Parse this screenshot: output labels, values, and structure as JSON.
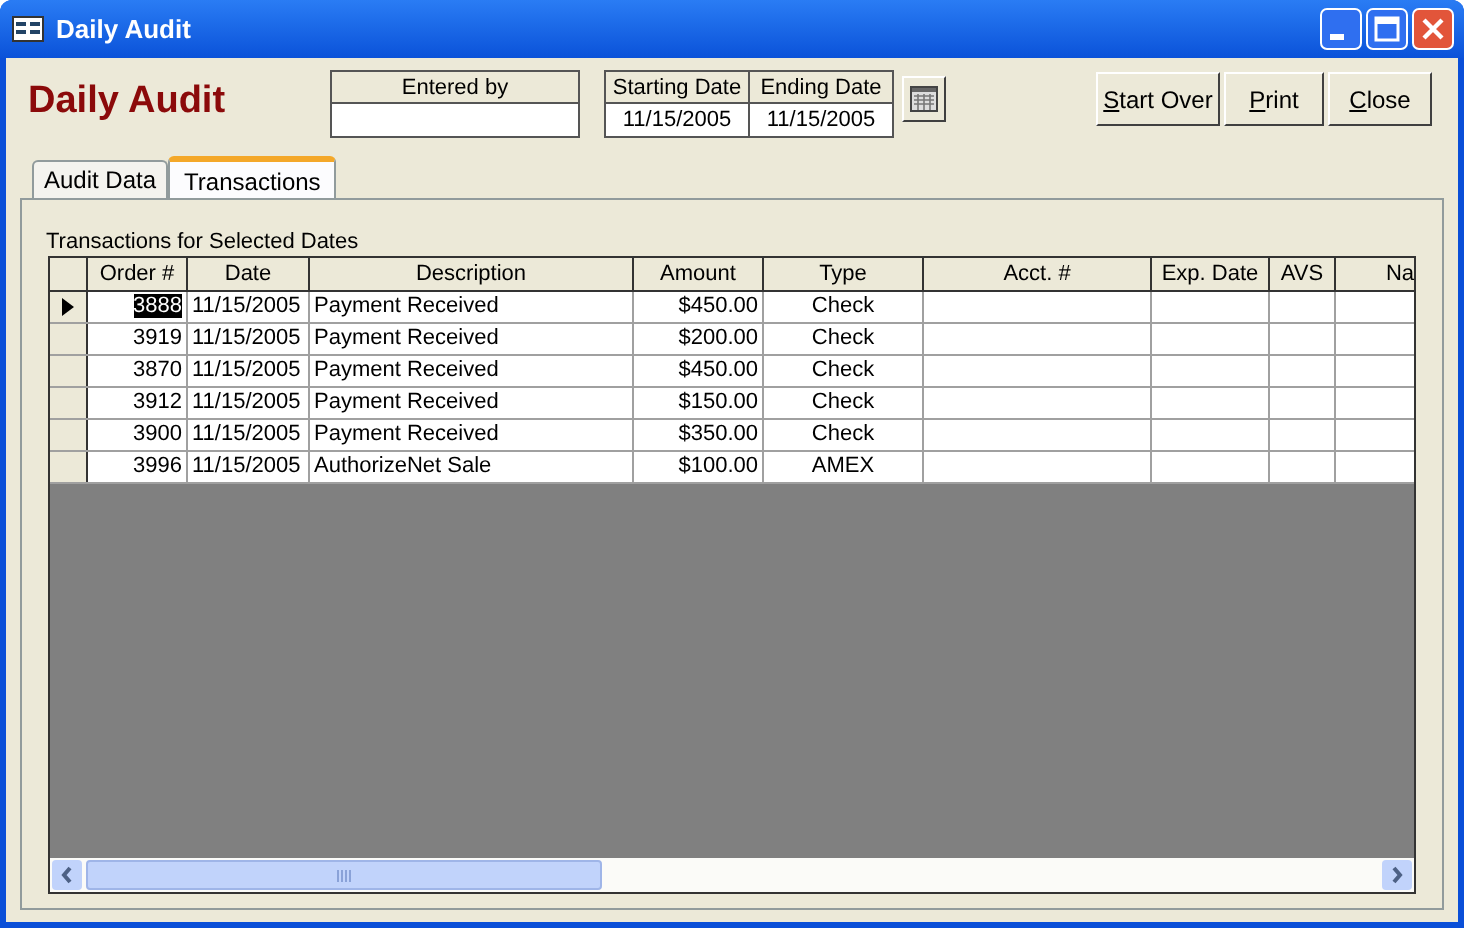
{
  "window": {
    "title": "Daily Audit"
  },
  "header": {
    "title": "Daily Audit",
    "entered_by": {
      "label": "Entered by"
    },
    "starting_date": {
      "label": "Starting Date",
      "value": "11/15/2005"
    },
    "ending_date": {
      "label": "Ending Date",
      "value": "11/15/2005"
    }
  },
  "buttons": [
    {
      "label": "Start Over",
      "underline_first": true
    },
    {
      "label": "Print",
      "underline_first": true
    },
    {
      "label": "Close",
      "underline_first": true
    }
  ],
  "tabs": [
    {
      "label": "Audit Data",
      "selected": false
    },
    {
      "label": "Transactions",
      "selected": true
    }
  ],
  "grid": {
    "caption": "Transactions for Selected Dates",
    "columns": [
      "Order #",
      "Date",
      "Description",
      "Amount",
      "Type",
      "Acct. #",
      "Exp. Date",
      "AVS",
      "Na"
    ],
    "rows": [
      {
        "selected": true,
        "cells": [
          "3888",
          "11/15/2005",
          "Payment Received",
          "$450.00",
          "Check"
        ]
      },
      {
        "selected": false,
        "cells": [
          "3919",
          "11/15/2005",
          "Payment Received",
          "$200.00",
          "Check"
        ]
      },
      {
        "selected": false,
        "cells": [
          "3870",
          "11/15/2005",
          "Payment Received",
          "$450.00",
          "Check"
        ]
      },
      {
        "selected": false,
        "cells": [
          "3912",
          "11/15/2005",
          "Payment Received",
          "$150.00",
          "Check"
        ]
      },
      {
        "selected": false,
        "cells": [
          "3900",
          "11/15/2005",
          "Payment Received",
          "$350.00",
          "Check"
        ]
      },
      {
        "selected": false,
        "cells": [
          "3996",
          "11/15/2005",
          "AuthorizeNet Sale",
          "$100.00",
          "AMEX"
        ]
      }
    ]
  }
}
